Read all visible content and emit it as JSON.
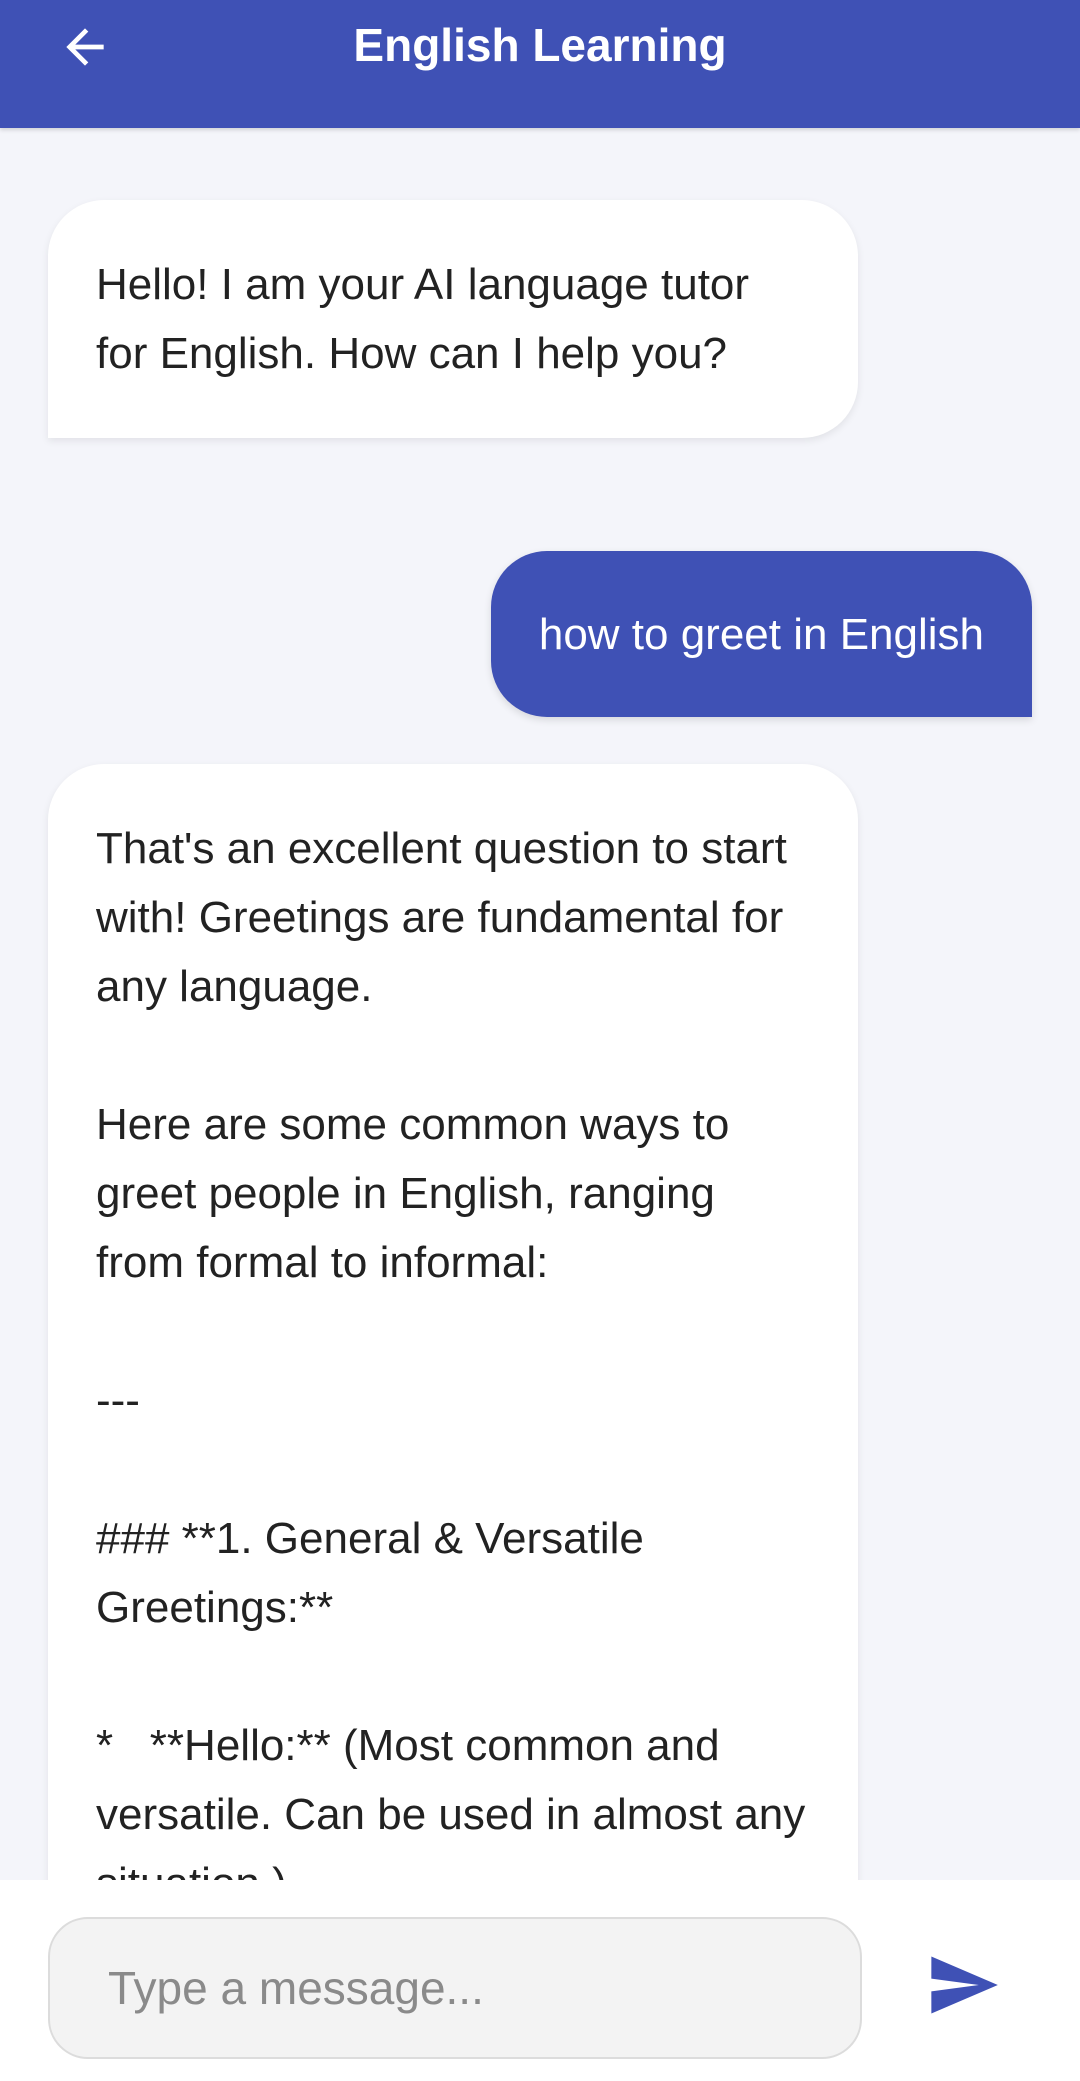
{
  "app_bar": {
    "title": "English Learning",
    "back_icon": "arrow-left-icon",
    "color": "#3f51b5"
  },
  "messages": [
    {
      "sender": "ai",
      "text": "Hello! I am your AI language tutor for English. How can I help you?"
    },
    {
      "sender": "user",
      "text": "how to greet in English"
    },
    {
      "sender": "ai",
      "text": "That's an excellent question to start with! Greetings are fundamental for any language.\n\nHere are some common ways to greet people in English, ranging from formal to informal:\n\n---\n\n### **1. General & Versatile Greetings:**\n\n*   **Hello:** (Most common and versatile. Can be used in almost any situation.)"
    }
  ],
  "composer": {
    "placeholder": "Type a message...",
    "value": "",
    "send_icon": "send-icon"
  }
}
